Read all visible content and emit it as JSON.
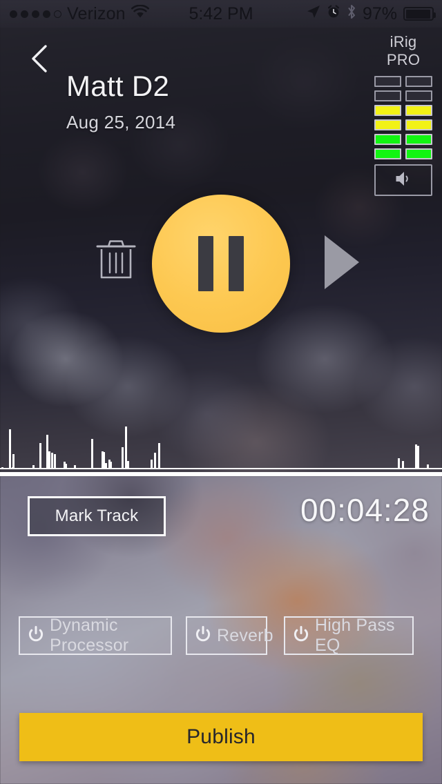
{
  "status_bar": {
    "signal_dots_filled": 4,
    "signal_dots_total": 5,
    "carrier": "Verizon",
    "wifi_icon": "wifi-icon",
    "time": "5:42 PM",
    "location_icon": "location-arrow-icon",
    "alarm_icon": "alarm-clock-icon",
    "bluetooth_icon": "bluetooth-icon",
    "battery_percent": "97%",
    "battery_icon": "battery-full-icon"
  },
  "header": {
    "back_icon": "back-chevron-icon",
    "title": "Matt D2",
    "subtitle": "Aug 25, 2014"
  },
  "input_device": {
    "label": "iRig PRO",
    "speaker_icon": "speaker-icon",
    "meter_rows": [
      {
        "left": "off",
        "right": "off"
      },
      {
        "left": "off",
        "right": "off"
      },
      {
        "left": "yellow",
        "right": "yellow"
      },
      {
        "left": "yellow",
        "right": "yellow"
      },
      {
        "left": "green",
        "right": "green"
      },
      {
        "left": "green",
        "right": "green"
      }
    ],
    "colors": {
      "off": "#2c2b35",
      "yellow": "#f2f216",
      "green": "#12f512",
      "border": "#9a9aa6"
    }
  },
  "transport": {
    "delete_icon": "trash-icon",
    "primary_button_icon": "pause-icon",
    "primary_button_color": "#fdc851",
    "primary_button_state": "recording",
    "play_icon": "play-icon",
    "play_icon_color": "#9a9aa4"
  },
  "waveform": {
    "bar_color": "#ffffff",
    "baseline_color": "#ffffff",
    "heights": [
      2,
      2,
      2,
      3,
      2,
      2,
      2,
      2,
      2,
      2,
      2,
      2,
      2,
      2,
      2,
      2,
      2,
      2,
      2,
      2,
      2,
      2,
      2,
      58,
      2,
      2,
      2,
      2,
      2,
      3,
      22,
      2,
      2,
      2,
      2,
      2,
      2,
      2,
      2,
      2,
      2,
      2,
      2,
      2,
      2,
      2,
      2,
      2,
      2,
      2,
      2,
      2,
      2,
      2,
      2,
      2,
      2,
      2,
      2,
      2,
      2,
      2,
      2,
      2,
      2,
      2,
      2,
      2,
      2,
      2,
      2,
      2,
      2,
      2,
      2,
      2,
      2,
      2,
      2,
      2,
      6,
      2,
      2,
      2,
      2,
      2,
      2,
      2,
      2,
      2,
      2,
      2,
      2,
      2,
      2,
      2,
      2,
      38,
      2,
      2,
      2,
      2,
      2,
      2,
      2,
      2,
      2,
      2,
      2,
      2,
      2,
      2,
      2,
      2,
      50,
      2,
      2,
      2,
      2,
      2,
      26,
      2,
      2,
      2,
      2,
      2,
      2,
      24,
      2,
      2,
      2,
      2,
      2,
      22,
      2,
      2,
      2,
      2,
      2,
      2,
      2,
      2,
      2,
      2,
      2,
      2,
      2,
      2,
      2,
      2,
      2,
      2,
      2,
      2,
      2,
      2,
      2,
      2,
      11,
      2,
      2,
      8,
      2,
      2,
      2,
      2,
      2,
      2,
      2,
      2,
      2,
      2,
      2,
      2,
      2,
      2,
      2,
      2,
      2,
      2,
      2,
      2,
      2,
      6,
      2,
      2,
      2,
      2,
      2,
      2,
      2,
      2,
      2,
      2,
      2,
      2,
      2,
      2,
      2,
      2,
      2,
      2,
      2,
      2,
      2,
      2,
      2,
      2,
      2,
      2,
      2,
      2,
      2,
      2,
      2,
      2,
      2,
      2,
      2,
      2,
      2,
      2,
      2,
      2,
      2,
      2,
      44,
      2,
      2,
      2,
      2,
      2,
      2,
      2,
      2,
      2,
      2,
      2,
      2,
      2,
      2,
      2,
      2,
      2,
      2,
      2,
      2,
      2,
      2,
      2,
      2,
      26,
      2,
      2,
      25,
      2,
      2,
      2,
      2,
      2,
      9,
      2,
      2,
      2,
      2,
      2,
      2,
      2,
      2,
      14,
      2,
      2,
      11,
      2,
      2,
      2,
      2,
      2,
      2,
      2,
      2,
      2,
      2,
      2,
      2,
      2,
      2,
      2,
      2,
      2,
      2,
      2,
      2,
      2,
      2,
      2,
      2,
      2,
      2,
      2,
      2,
      32,
      2,
      2,
      2,
      2,
      2,
      2,
      2,
      62,
      2,
      2,
      2,
      2,
      2,
      12,
      2,
      2,
      2,
      2,
      2,
      2,
      2,
      2,
      2,
      2,
      2,
      2,
      2,
      2,
      2,
      2,
      2,
      2,
      2,
      2,
      2,
      2,
      2,
      2,
      2,
      2,
      2,
      2,
      2,
      2,
      2,
      2,
      2,
      2,
      2,
      2,
      2,
      2,
      2,
      2,
      2,
      2,
      2,
      2,
      2,
      2,
      2,
      2,
      2,
      2,
      2,
      2,
      2,
      2,
      2,
      2,
      2,
      14,
      2,
      2,
      2,
      2,
      2,
      2,
      2,
      24,
      2,
      2,
      2,
      2,
      2,
      2,
      2,
      2,
      2,
      38,
      2,
      2,
      2,
      2,
      2,
      2,
      2,
      2,
      2,
      2,
      2,
      2,
      2,
      2,
      2,
      2,
      2,
      2,
      2,
      2,
      2,
      2,
      2,
      2,
      2,
      2,
      2,
      2,
      2,
      2,
      2,
      2,
      2,
      2,
      2,
      2,
      2,
      2,
      2,
      2,
      2,
      2,
      2,
      2,
      2,
      2,
      2,
      2,
      2,
      2,
      2,
      2,
      2,
      2,
      2,
      2,
      2,
      2,
      2,
      2,
      2,
      2,
      2,
      2,
      2,
      2,
      2,
      2,
      2,
      2,
      2,
      2,
      2,
      2,
      2,
      2,
      2,
      2,
      2,
      2,
      2,
      2,
      2,
      2,
      2,
      2,
      2,
      2,
      2,
      2,
      2,
      2,
      2,
      2,
      2,
      2,
      2,
      2,
      2,
      2,
      2,
      2,
      2,
      2,
      2,
      2,
      2,
      2,
      2,
      2,
      2,
      2,
      2,
      2,
      2,
      2,
      2,
      2,
      2,
      2,
      2,
      2,
      2,
      2,
      2,
      2,
      2,
      2,
      2,
      2,
      2,
      2,
      2,
      2,
      2,
      2,
      2,
      2,
      2,
      2,
      2,
      2,
      2,
      2,
      2,
      2,
      2,
      2,
      2,
      2,
      2,
      2,
      2,
      2,
      2,
      2,
      2,
      2,
      2,
      2,
      2,
      2,
      2,
      2,
      2,
      2,
      2,
      2,
      2,
      2,
      2,
      2,
      2,
      2,
      2,
      2,
      2,
      2,
      2,
      2,
      2,
      2,
      2,
      2,
      2,
      2,
      2,
      2,
      2,
      2,
      2,
      2,
      2,
      2,
      2,
      2,
      2,
      2,
      2,
      2,
      2,
      2,
      2,
      2,
      2,
      2,
      2,
      2,
      2,
      2,
      2,
      2,
      2,
      2,
      2,
      2,
      2,
      2,
      2,
      2,
      2,
      2,
      2,
      2,
      2,
      2,
      2,
      2,
      2,
      2,
      2,
      2,
      2,
      2,
      2,
      2,
      2,
      2,
      2,
      2,
      2,
      2,
      2,
      2,
      2,
      2,
      2,
      2,
      2,
      2,
      2,
      2,
      2,
      2,
      2,
      2,
      2,
      2,
      2,
      2,
      2,
      2,
      2,
      2,
      2,
      2,
      2,
      2,
      2,
      2,
      2,
      2,
      2,
      2,
      2,
      2,
      2,
      2,
      2,
      2,
      2,
      2,
      2,
      2,
      2,
      2,
      2,
      2,
      2,
      2,
      2,
      2,
      2,
      2,
      2,
      2,
      2,
      2,
      2,
      2,
      2,
      2,
      2,
      2,
      2,
      2,
      2,
      2,
      2,
      2,
      2,
      2,
      2,
      2,
      2,
      2,
      2,
      2,
      2,
      2,
      2,
      2,
      2,
      2,
      2,
      2,
      2,
      2,
      2,
      2,
      2,
      2,
      2,
      2,
      2,
      2,
      2,
      2,
      2,
      2,
      2,
      2,
      2,
      2,
      2,
      2,
      2,
      2,
      2,
      2,
      2,
      2,
      2,
      2,
      2,
      2,
      2,
      2,
      2,
      2,
      2,
      2,
      2,
      2,
      2,
      2,
      2,
      2,
      2,
      2,
      2,
      2,
      2,
      2,
      2,
      2,
      2,
      2,
      2,
      2,
      2,
      2,
      2,
      2,
      2,
      2,
      2,
      2,
      2,
      2,
      2,
      2,
      2,
      2,
      2,
      2,
      2,
      2,
      2,
      2,
      2,
      2,
      2,
      2,
      2,
      2,
      2,
      2,
      2,
      2,
      2,
      2,
      2,
      2,
      2,
      2,
      2,
      2,
      2,
      2,
      2,
      2,
      2,
      2,
      2,
      2,
      2,
      2,
      2,
      2,
      2,
      2,
      2,
      2,
      2,
      2,
      2,
      2,
      2,
      2,
      2,
      2,
      2,
      2,
      2,
      2,
      2,
      2,
      2,
      2,
      2,
      2,
      2,
      2,
      2,
      2,
      2,
      2,
      2,
      2,
      2,
      2,
      2,
      2,
      2,
      2,
      2,
      2,
      2,
      2,
      2,
      2,
      2,
      2,
      2,
      2,
      2,
      2,
      2,
      2,
      2,
      2,
      2,
      2,
      2,
      2,
      2,
      2,
      2,
      2,
      2,
      2,
      2,
      2,
      2,
      2,
      2,
      2,
      2,
      2,
      2,
      2,
      2,
      2,
      2,
      2,
      2,
      2,
      2,
      2,
      2,
      2,
      2,
      2,
      2,
      2,
      2,
      2,
      2,
      2,
      2,
      2,
      2,
      2,
      2,
      2,
      2,
      2,
      2,
      2,
      2,
      2,
      2,
      2,
      2,
      2,
      2,
      2,
      2,
      2,
      2,
      2,
      2,
      2,
      2,
      2,
      2,
      2,
      2,
      2,
      2,
      2,
      2,
      2,
      2,
      2,
      2,
      2,
      2,
      2,
      2,
      2,
      2,
      2,
      2,
      2,
      2,
      2,
      2,
      2,
      2,
      2,
      2,
      2,
      2,
      2,
      2,
      2,
      2,
      2,
      2,
      2,
      2,
      2,
      2,
      2,
      2,
      2,
      2,
      2,
      2,
      2,
      16,
      2,
      2,
      2,
      2,
      2,
      2,
      2,
      2,
      2,
      2,
      12,
      2,
      2,
      2,
      2,
      2,
      2,
      2,
      2,
      2,
      2,
      2,
      2,
      2,
      2,
      2,
      2,
      2,
      2,
      2,
      2,
      2,
      2,
      2,
      2,
      2,
      2,
      2,
      2,
      2,
      2,
      2,
      2,
      36,
      2,
      2,
      2,
      34,
      2,
      2,
      2,
      2,
      2,
      2,
      2,
      2,
      2,
      2,
      2,
      2,
      2,
      2,
      2,
      2,
      2,
      2,
      2,
      2,
      2,
      2,
      2,
      2,
      7,
      2,
      2,
      2,
      2,
      2,
      2,
      2,
      2,
      2,
      2,
      2,
      2,
      2,
      2,
      2,
      2,
      2,
      2,
      2,
      2,
      2,
      2,
      2,
      2,
      2,
      2,
      2,
      2,
      2,
      2,
      2,
      2,
      2,
      2,
      2,
      2
    ]
  },
  "controls": {
    "mark_track_label": "Mark Track",
    "timer": "00:04:28"
  },
  "effects": [
    {
      "label": "Dynamic Processor",
      "icon": "power-icon",
      "enabled": false
    },
    {
      "label": "Reverb",
      "icon": "power-icon",
      "enabled": false
    },
    {
      "label": "High Pass EQ",
      "icon": "power-icon",
      "enabled": false
    }
  ],
  "publish": {
    "label": "Publish",
    "color": "#efbe17",
    "text_color": "#26262c"
  }
}
